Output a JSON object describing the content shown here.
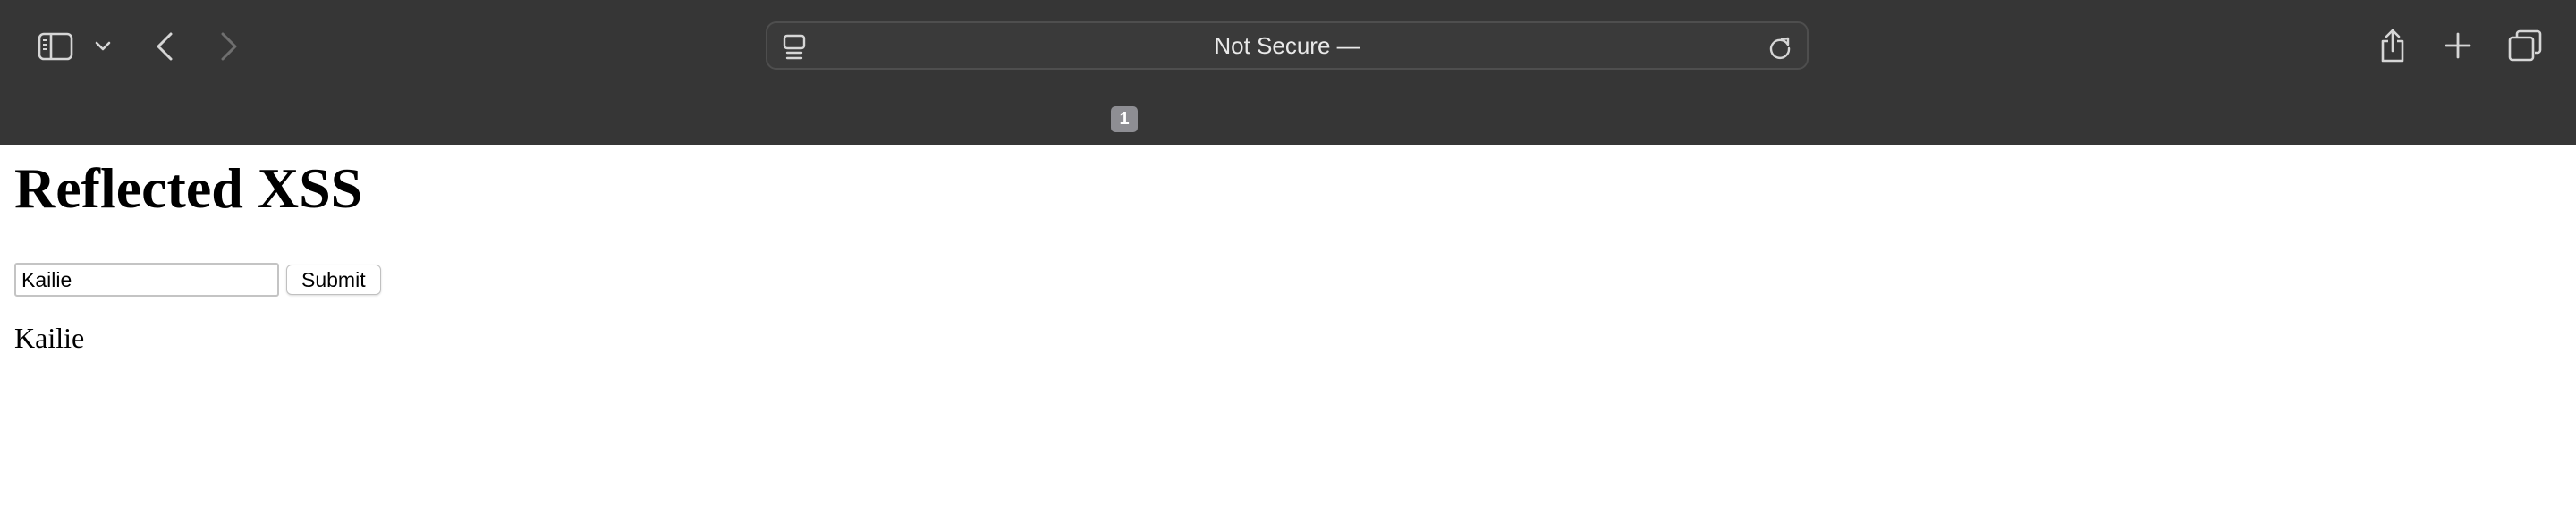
{
  "browser": {
    "icons": {
      "sidebar": "sidebar-icon",
      "sidebar_menu": "chevron-down-icon",
      "back": "chevron-left-icon",
      "forward": "chevron-right-icon",
      "reader": "reader-icon",
      "reload": "reload-icon",
      "share": "share-icon",
      "new_tab": "plus-icon",
      "tab_overview": "tab-overview-icon"
    },
    "address_bar": {
      "text": "Not Secure —"
    },
    "tab_group_badge": "1",
    "colors": {
      "toolbar_background": "#363636",
      "icon": "#d6d6d6",
      "icon_disabled": "#6f6f6f",
      "badge": "#8e8e93"
    }
  },
  "page": {
    "title": "Reflected XSS",
    "form": {
      "input_value": "Kailie",
      "submit_label": "Submit"
    },
    "output_text": "Kailie"
  }
}
